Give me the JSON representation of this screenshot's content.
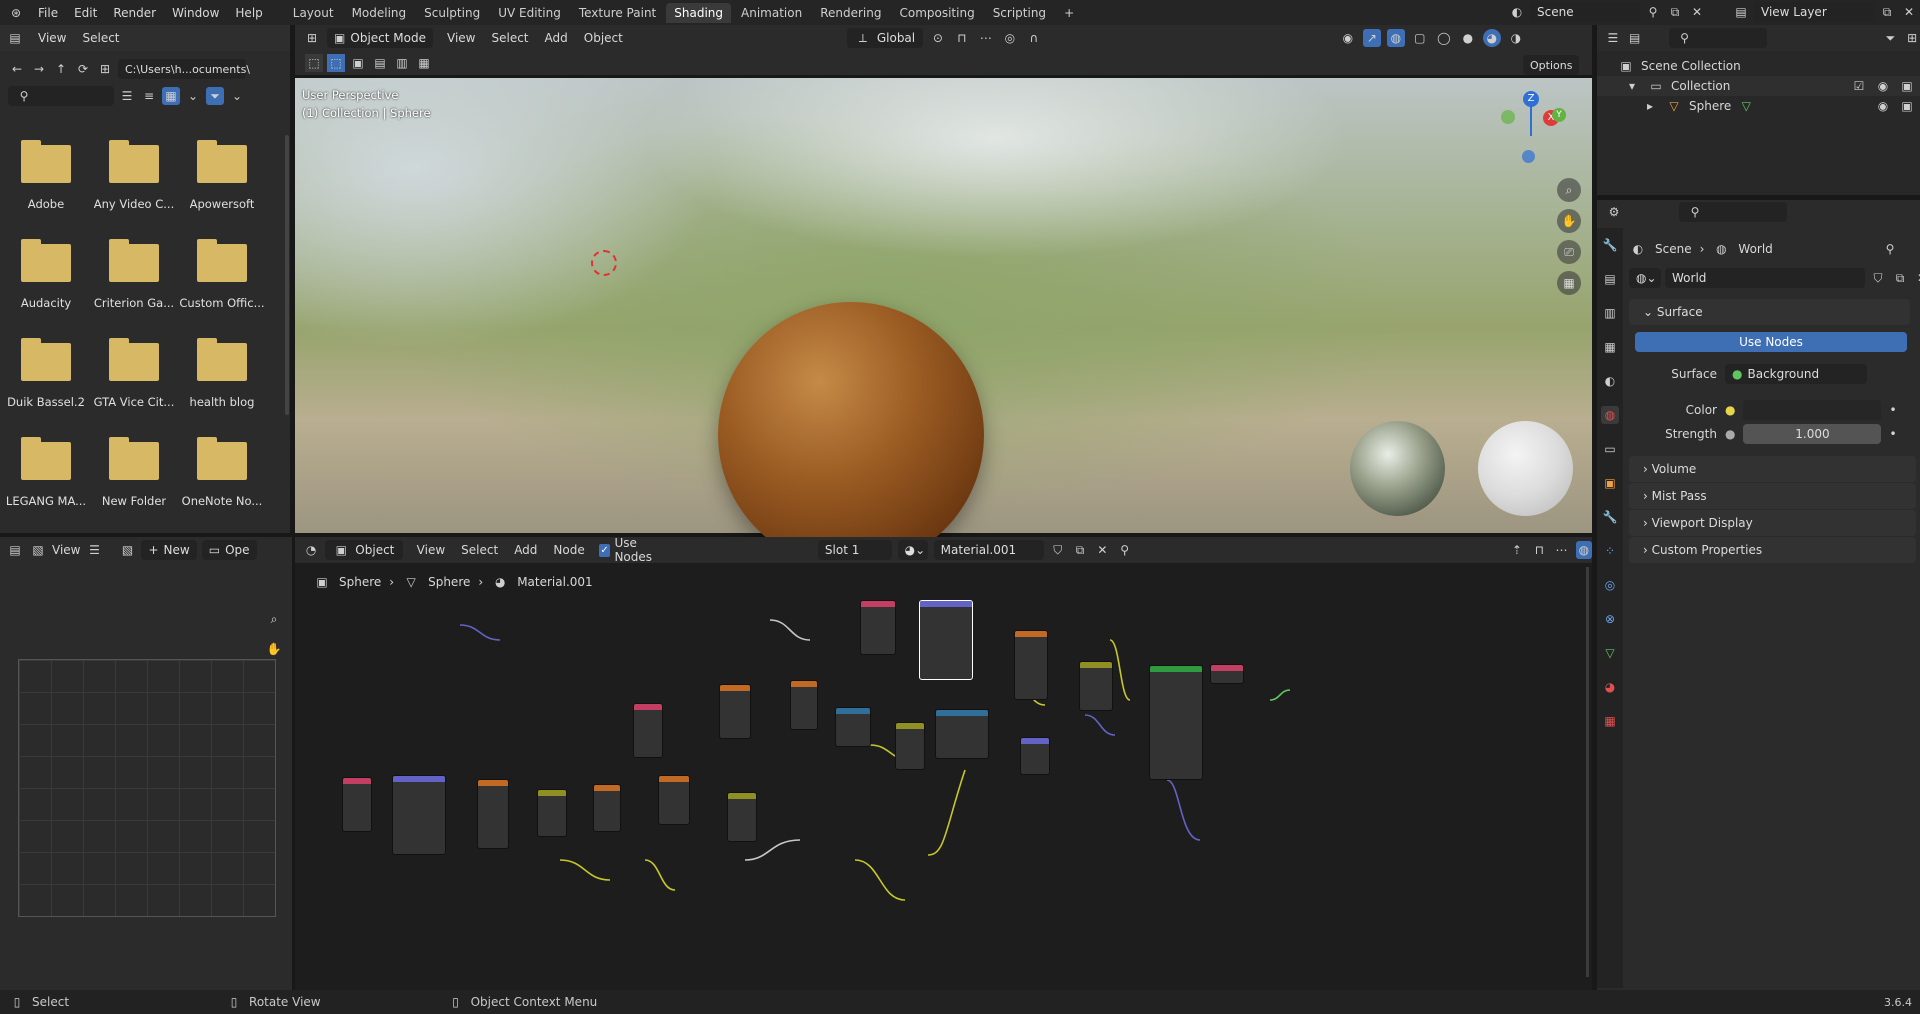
{
  "topbar": {
    "menus": [
      "File",
      "Edit",
      "Render",
      "Window",
      "Help"
    ],
    "tabs": [
      "Layout",
      "Modeling",
      "Sculpting",
      "UV Editing",
      "Texture Paint",
      "Shading",
      "Animation",
      "Rendering",
      "Compositing",
      "Scripting"
    ],
    "active_tab": "Shading",
    "add_tab": "+",
    "scene": "Scene",
    "view_layer": "View Layer"
  },
  "filebrowser": {
    "menus": [
      "View",
      "Select"
    ],
    "path": "C:\\Users\\h...ocuments\\",
    "search_placeholder": "",
    "folders": [
      "Adobe",
      "Any Video C...",
      "Apowersoft",
      "Audacity",
      "Criterion Ga...",
      "Custom Offic...",
      "Duik Bassel.2",
      "GTA Vice Cit...",
      "health blog",
      "LEGANG MA...",
      "New Folder",
      "OneNote No..."
    ]
  },
  "viewport": {
    "mode": "Object Mode",
    "menus": [
      "View",
      "Select",
      "Add",
      "Object"
    ],
    "transform": "Global",
    "options": "Options",
    "overlay_line1": "User Perspective",
    "overlay_line2": "(1) Collection | Sphere",
    "gizmo": {
      "z": "Z",
      "x": "X",
      "y": "Y"
    }
  },
  "outliner": {
    "search_placeholder": "",
    "scene_collection": "Scene Collection",
    "collection": "Collection",
    "object": "Sphere"
  },
  "properties": {
    "breadcrumb": [
      "Scene",
      "World"
    ],
    "world_name": "World",
    "surface_section": "Surface",
    "use_nodes": "Use Nodes",
    "surface_label": "Surface",
    "surface_value": "Background",
    "color_label": "Color",
    "strength_label": "Strength",
    "strength_value": "1.000",
    "sections": [
      "Volume",
      "Mist Pass",
      "Viewport Display",
      "Custom Properties"
    ]
  },
  "image_editor": {
    "view": "View",
    "new": "New",
    "open": "Ope"
  },
  "node_editor": {
    "object": "Object",
    "menus": [
      "View",
      "Select",
      "Add",
      "Node"
    ],
    "use_nodes": "Use Nodes",
    "slot": "Slot 1",
    "material": "Material.001",
    "breadcrumb": [
      "Sphere",
      "Sphere",
      "Material.001"
    ]
  },
  "status": {
    "select": "Select",
    "rotate": "Rotate View",
    "context": "Object Context Menu",
    "version": "3.6.4"
  }
}
